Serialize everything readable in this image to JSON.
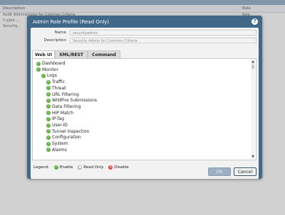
{
  "background": {
    "headers": {
      "description": "Description",
      "role": "Role"
    },
    "rows": [
      {
        "description": "Audit Administrator for Common Criteria",
        "role": "Role"
      },
      {
        "description": "Crypto ...",
        "role": "Role"
      },
      {
        "description": "Security...",
        "role": ""
      }
    ]
  },
  "dialog": {
    "title": "Admin Role Profile (Read Only)",
    "help_icon": "?",
    "name_label": "Name",
    "name_value": "securityadmin",
    "description_label": "Description",
    "description_value": "Security Admin for Common Criteria",
    "tabs": [
      {
        "label": "Web UI",
        "active": true
      },
      {
        "label": "XML/REST API",
        "active": false
      },
      {
        "label": "Command Line",
        "active": false
      }
    ],
    "tree": [
      {
        "label": "Dashboard",
        "level": 0
      },
      {
        "label": "Monitor",
        "level": 0
      },
      {
        "label": "Logs",
        "level": 1
      },
      {
        "label": "Traffic",
        "level": 2
      },
      {
        "label": "Threat",
        "level": 2
      },
      {
        "label": "URL Filtering",
        "level": 2
      },
      {
        "label": "WildFire Submissions",
        "level": 2
      },
      {
        "label": "Data Filtering",
        "level": 2
      },
      {
        "label": "HIP Match",
        "level": 2
      },
      {
        "label": "IP-Tag",
        "level": 2
      },
      {
        "label": "User-ID",
        "level": 2
      },
      {
        "label": "Tunnel Inspection",
        "level": 2
      },
      {
        "label": "Configuration",
        "level": 2
      },
      {
        "label": "System",
        "level": 2
      },
      {
        "label": "Alarms",
        "level": 2
      }
    ],
    "legend": {
      "title": "Legend:",
      "enable": "Enable",
      "read_only": "Read Only",
      "disable": "Disable"
    },
    "ok_button": "OK",
    "cancel_button": "Cancel"
  },
  "colors": {
    "dialog_bg": "#3f6889",
    "enable": "#5fae3a",
    "read_only": "#9a9a9a",
    "disable": "#d94040"
  },
  "icons": {
    "check": "check-icon",
    "help": "help-icon"
  }
}
